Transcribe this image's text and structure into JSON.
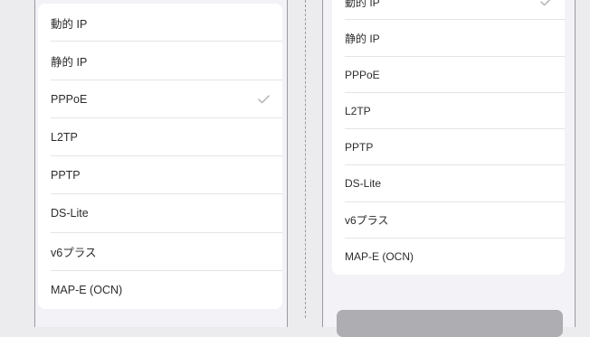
{
  "left_panel": {
    "options": [
      {
        "label": "動的 IP",
        "selected": false
      },
      {
        "label": "静的 IP",
        "selected": false
      },
      {
        "label": "PPPoE",
        "selected": true
      },
      {
        "label": "L2TP",
        "selected": false
      },
      {
        "label": "PPTP",
        "selected": false
      },
      {
        "label": "DS-Lite",
        "selected": false
      },
      {
        "label": "v6プラス",
        "selected": false
      },
      {
        "label": "MAP-E (OCN)",
        "selected": false
      }
    ]
  },
  "right_panel": {
    "options": [
      {
        "label": "動的 IP",
        "selected": true
      },
      {
        "label": "静的 IP",
        "selected": false
      },
      {
        "label": "PPPoE",
        "selected": false
      },
      {
        "label": "L2TP",
        "selected": false
      },
      {
        "label": "PPTP",
        "selected": false
      },
      {
        "label": "DS-Lite",
        "selected": false
      },
      {
        "label": "v6プラス",
        "selected": false
      },
      {
        "label": "MAP-E (OCN)",
        "selected": false
      }
    ]
  },
  "icons": {
    "selected": "checkmark-icon"
  },
  "colors": {
    "checkmark": "#b4b4ba",
    "background": "#f2f2f7",
    "button_disabled": "#aeaeb2"
  }
}
